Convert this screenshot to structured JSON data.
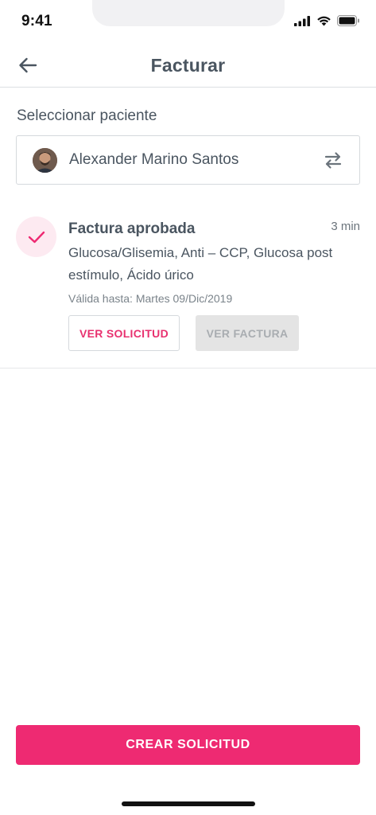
{
  "status_bar": {
    "time": "9:41"
  },
  "nav": {
    "title": "Facturar",
    "back_icon": "arrow-left-icon"
  },
  "patient_section": {
    "label": "Seleccionar paciente",
    "patient_name": "Alexander Marino Santos",
    "swap_icon": "swap-arrows-icon"
  },
  "invoice": {
    "status_icon": "check-icon",
    "title": "Factura aprobada",
    "time": "3 min",
    "description": "Glucosa/Glisemia, Anti – CCP, Glucosa post estímulo, Ácido úrico",
    "valid_until": "Válida hasta: Martes 09/Dic/2019",
    "view_request_label": "VER SOLICITUD",
    "view_invoice_label": "VER FACTURA"
  },
  "cta": {
    "label": "CREAR SOLICITUD"
  },
  "colors": {
    "accent": "#ee2a72",
    "accent_light": "#fdeaf1",
    "text": "#4a5560",
    "disabled_bg": "#e4e4e4"
  }
}
